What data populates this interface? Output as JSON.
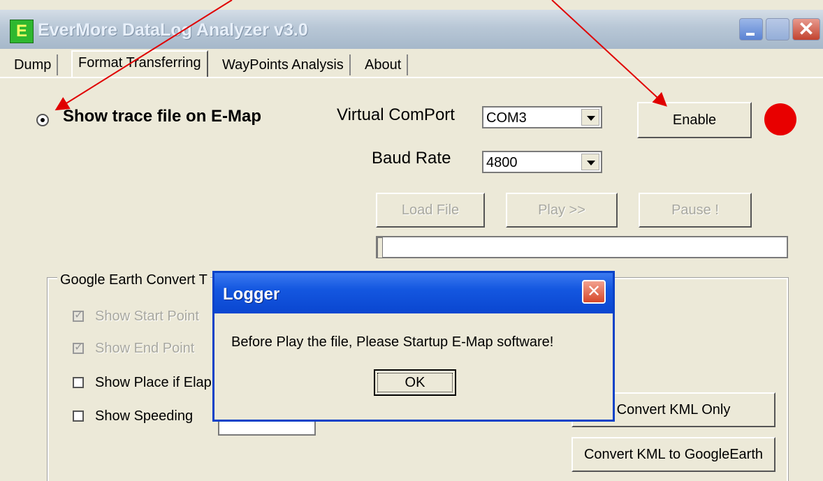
{
  "window": {
    "title": "EverMore DataLog Analyzer v3.0",
    "icon_letter": "E"
  },
  "tabs": [
    {
      "label": "Dump"
    },
    {
      "label": "Format Transferring",
      "active": true
    },
    {
      "label": "WayPoints Analysis"
    },
    {
      "label": "About"
    }
  ],
  "main": {
    "radio_label": "Show trace file on E-Map",
    "comport_label": "Virtual ComPort",
    "comport_value": "COM3",
    "baud_label": "Baud Rate",
    "baud_value": "4800",
    "enable_label": "Enable",
    "load_label": "Load File",
    "play_label": "Play >>",
    "pause_label": "Pause !",
    "status_led_color": "#e80000"
  },
  "group": {
    "title": "Google Earth Convert T",
    "show_start": "Show Start Point",
    "show_end": "Show End Point",
    "show_place": "Show Place if Elap",
    "show_speeding": "Show Speeding",
    "convert_kml_only": "Convert KML Only",
    "convert_kml_ge": "Convert KML to GoogleEarth"
  },
  "dialog": {
    "title": "Logger",
    "message": "Before Play the file, Please Startup E-Map software!",
    "ok_label": "OK"
  },
  "icons": {
    "close": "close-icon",
    "minimize": "minimize-icon",
    "maximize": "maximize-icon",
    "dropdown": "chevron-down-icon",
    "check": "check-icon"
  },
  "colors": {
    "annotation_arrow": "#e00000",
    "dialog_titlebar": "#0a46d0"
  }
}
